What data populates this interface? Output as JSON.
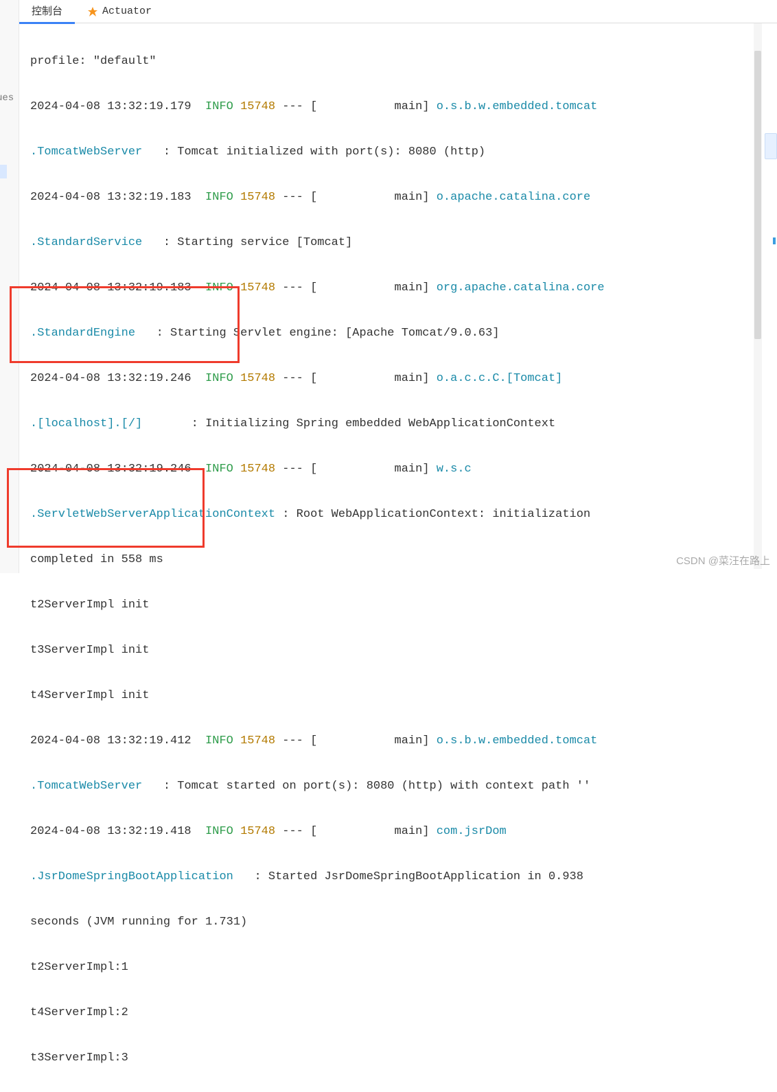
{
  "tabs": {
    "console": "控制台",
    "actuator": "Actuator"
  },
  "left": {
    "cut": "ues"
  },
  "colors": {
    "info": "#2e9c4a",
    "pid": "#b37a00",
    "logger": "#1a8aa8",
    "box": "#ef3b2c"
  },
  "log": {
    "l0": {
      "msg1": "profile: \"default\""
    },
    "l1": {
      "ts": "2024-04-08 13:32:19.179",
      "level": "INFO",
      "pid": "15748",
      "sep": "--- [",
      "thread": "main]",
      "logger": "o.s.b.w.embedded.tomcat"
    },
    "l2": {
      "logger": ".TomcatWebServer",
      "colon": "   : ",
      "msg": "Tomcat initialized with port(s): 8080 (http)"
    },
    "l3": {
      "ts": "2024-04-08 13:32:19.183",
      "level": "INFO",
      "pid": "15748",
      "sep": "--- [",
      "thread": "main]",
      "logger": "o.apache.catalina.core"
    },
    "l4": {
      "logger": ".StandardService",
      "colon": "   : ",
      "msg": "Starting service [Tomcat]"
    },
    "l5": {
      "ts": "2024-04-08 13:32:19.183",
      "level": "INFO",
      "pid": "15748",
      "sep": "--- [",
      "thread": "main]",
      "logger": "org.apache.catalina.core"
    },
    "l6": {
      "logger": ".StandardEngine",
      "colon": "   : ",
      "msg": "Starting Servlet engine: [Apache Tomcat/9.0.63]"
    },
    "l7": {
      "ts": "2024-04-08 13:32:19.246",
      "level": "INFO",
      "pid": "15748",
      "sep": "--- [",
      "thread": "main]",
      "logger": "o.a.c.c.C.[Tomcat]"
    },
    "l8": {
      "logger": ".[localhost].[/]",
      "colon": "       : ",
      "msg": "Initializing Spring embedded WebApplicationContext"
    },
    "l9": {
      "ts": "2024-04-08 13:32:19.246",
      "level": "INFO",
      "pid": "15748",
      "sep": "--- [",
      "thread": "main]",
      "logger": "w.s.c"
    },
    "l10": {
      "logger": ".ServletWebServerApplicationContext",
      "colon": " : ",
      "msg": "Root WebApplicationContext: initialization "
    },
    "l11": {
      "msg": "completed in 558 ms"
    },
    "l12": {
      "msg": "t2ServerImpl init"
    },
    "l13": {
      "msg": "t3ServerImpl init"
    },
    "l14": {
      "msg": "t4ServerImpl init"
    },
    "l15": {
      "ts": "2024-04-08 13:32:19.412",
      "level": "INFO",
      "pid": "15748",
      "sep": "--- [",
      "thread": "main]",
      "logger": "o.s.b.w.embedded.tomcat"
    },
    "l16": {
      "logger": ".TomcatWebServer",
      "colon": "   : ",
      "msg": "Tomcat started on port(s): 8080 (http) with context path ''"
    },
    "l17": {
      "ts": "2024-04-08 13:32:19.418",
      "level": "INFO",
      "pid": "15748",
      "sep": "--- [",
      "thread": "main]",
      "logger": "com.jsrDom"
    },
    "l18": {
      "logger": ".JsrDomeSpringBootApplication",
      "colon": "   : ",
      "msg": "Started JsrDomeSpringBootApplication in 0.938 "
    },
    "l19": {
      "msg": "seconds (JVM running for 1.731)"
    },
    "l20": {
      "msg": "t2ServerImpl:1"
    },
    "l21": {
      "msg": "t4ServerImpl:2"
    },
    "l22": {
      "msg": "t3ServerImpl:3"
    }
  },
  "watermark": "CSDN @菜汪在路上"
}
